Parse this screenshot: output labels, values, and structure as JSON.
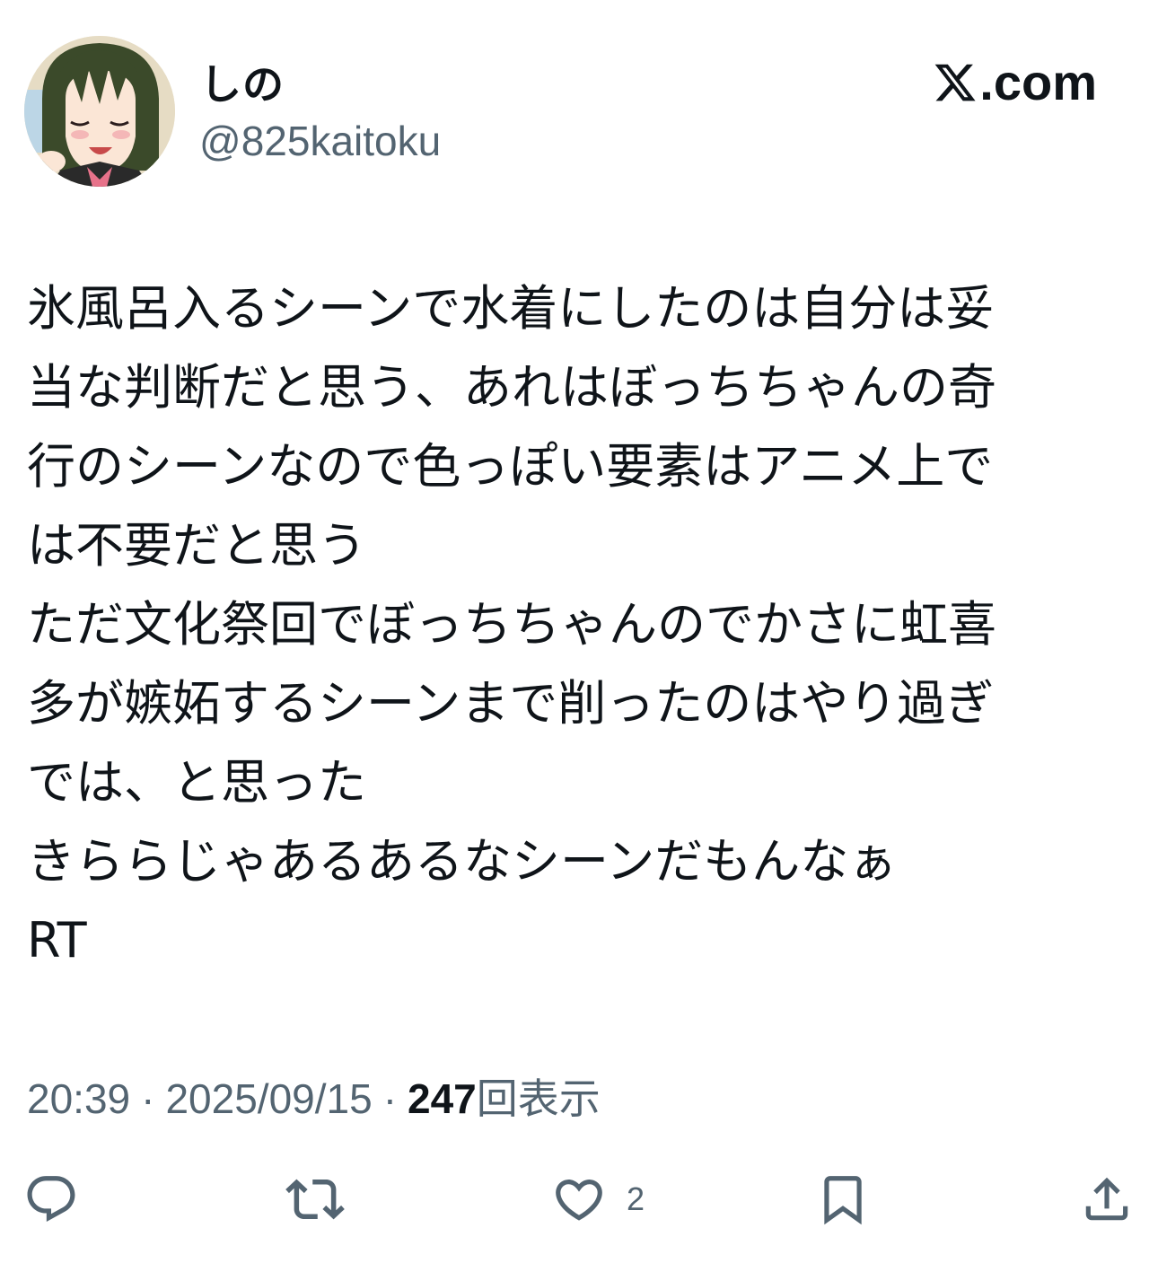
{
  "author": {
    "display_name": "しの",
    "handle": "@825kaitoku",
    "avatar_icon": "anime-character-avatar"
  },
  "brand": {
    "icon": "x-logo-icon",
    "text": ".com"
  },
  "post": {
    "lines": [
      "氷風呂入るシーンで水着にしたのは自分は妥",
      "当な判断だと思う、あれはぼっちちゃんの奇",
      "行のシーンなので色っぽい要素はアニメ上で",
      "は不要だと思う",
      "ただ文化祭回でぼっちちゃんのでかさに虹喜",
      "多が嫉妬するシーンまで削ったのはやり過ぎ",
      "では、と思った",
      "きららじゃあるあるなシーンだもんなぁ",
      "RT"
    ]
  },
  "meta": {
    "time": "20:39",
    "separator": "·",
    "date": "2025/09/15",
    "views_count": "247",
    "views_label": "回表示"
  },
  "actions": {
    "reply_icon": "reply-icon",
    "repost_icon": "repost-icon",
    "like_icon": "heart-icon",
    "like_count": "2",
    "bookmark_icon": "bookmark-icon",
    "share_icon": "share-icon"
  },
  "colors": {
    "text_primary": "#0f1419",
    "text_secondary": "#536471",
    "background": "#ffffff"
  }
}
